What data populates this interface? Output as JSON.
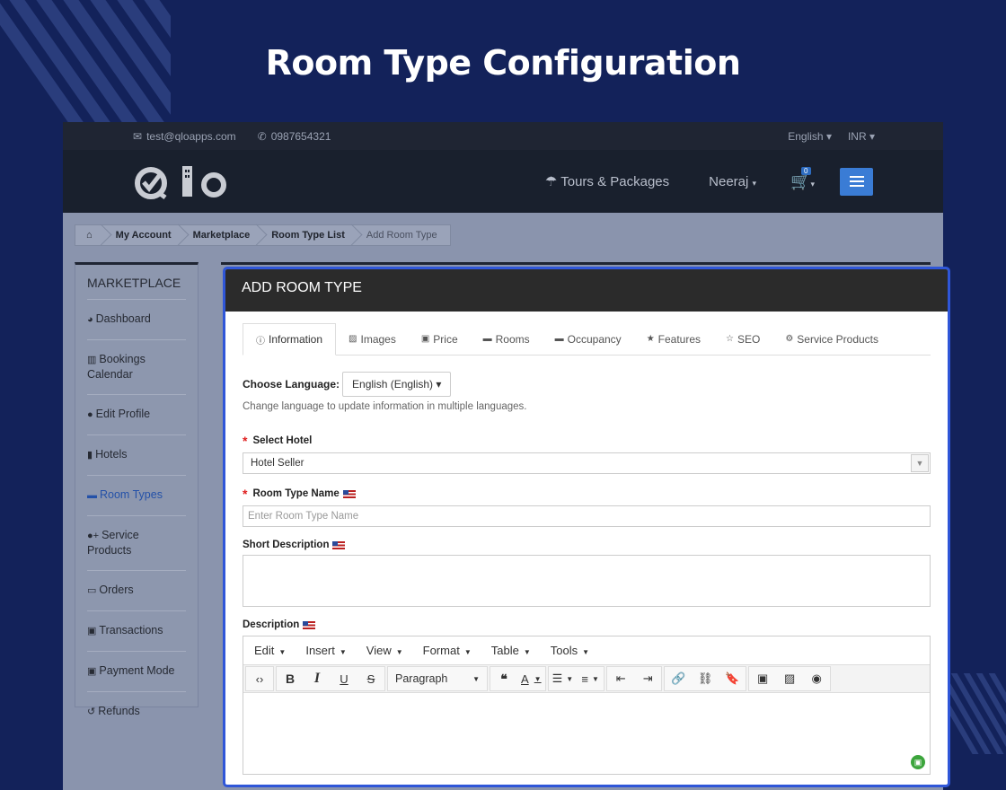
{
  "hero": {
    "title": "Room Type Configuration"
  },
  "topbar": {
    "email": "test@qloapps.com",
    "phone": "0987654321",
    "language": "English",
    "currency": "INR"
  },
  "navbar": {
    "logo_text": "qlo",
    "tours": "Tours & Packages",
    "user": "Neeraj",
    "cart_count": "0"
  },
  "breadcrumb": [
    "My Account",
    "Marketplace",
    "Room Type List",
    "Add Room Type"
  ],
  "sidebar": {
    "title": "MARKETPLACE",
    "items": [
      {
        "label": "Dashboard",
        "icon": "dashboard-icon"
      },
      {
        "label": "Bookings Calendar",
        "icon": "bar-chart-icon"
      },
      {
        "label": "Edit Profile",
        "icon": "user-icon"
      },
      {
        "label": "Hotels",
        "icon": "building-icon"
      },
      {
        "label": "Room Types",
        "icon": "bed-icon"
      },
      {
        "label": "Service Products",
        "icon": "user-plus-icon"
      },
      {
        "label": "Orders",
        "icon": "credit-card-icon"
      },
      {
        "label": "Transactions",
        "icon": "money-icon"
      },
      {
        "label": "Payment Mode",
        "icon": "money-icon"
      },
      {
        "label": "Refunds",
        "icon": "undo-icon"
      }
    ]
  },
  "panel": {
    "title": "ADD ROOM TYPE",
    "tabs": [
      "Information",
      "Images",
      "Price",
      "Rooms",
      "Occupancy",
      "Features",
      "SEO",
      "Service Products"
    ],
    "choose_language_label": "Choose Language:",
    "language_value": "English (English)",
    "language_help": "Change language to update information in multiple languages.",
    "select_hotel_label": "Select Hotel",
    "select_hotel_value": "Hotel Seller",
    "room_type_name_label": "Room Type Name",
    "room_type_name_placeholder": "Enter Room Type Name",
    "short_description_label": "Short Description",
    "description_label": "Description",
    "editor_menus": [
      "Edit",
      "Insert",
      "View",
      "Format",
      "Table",
      "Tools"
    ],
    "paragraph_format": "Paragraph"
  },
  "colors": {
    "accent": "#2f56d8",
    "background": "#13225a",
    "active_link": "#2451a8"
  }
}
